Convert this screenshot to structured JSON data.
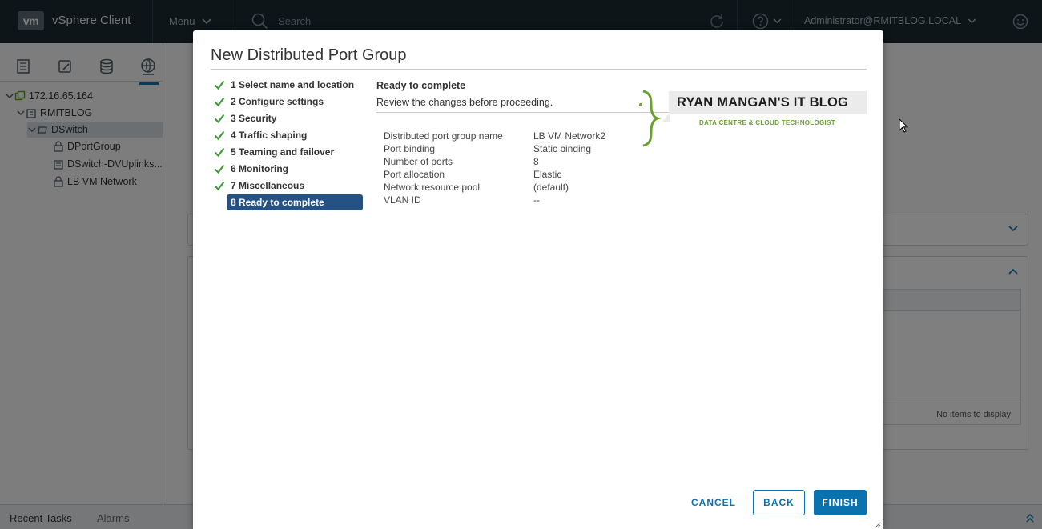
{
  "topbar": {
    "logo": "vm",
    "app_title": "vSphere Client",
    "menu_label": "Menu",
    "search_placeholder": "Search",
    "user_label": "Administrator@RMITBLOG.LOCAL"
  },
  "sidebar": {
    "tabs": [
      "hosts-clusters-icon",
      "vms-templates-icon",
      "storage-icon",
      "networking-icon"
    ],
    "tree": [
      {
        "label": "172.16.65.164",
        "icon": "vcenter-icon"
      },
      {
        "label": "RMITBLOG",
        "icon": "datacenter-icon"
      },
      {
        "label": "DSwitch",
        "icon": "distributed-switch-icon"
      },
      {
        "label": "DPortGroup",
        "icon": "port-group-icon"
      },
      {
        "label": "DSwitch-DVUplinks...",
        "icon": "uplink-icon"
      },
      {
        "label": "LB VM Network",
        "icon": "port-group-icon"
      }
    ]
  },
  "background": {
    "no_items_text": "No items to display"
  },
  "bottom_bar": {
    "recent_tasks": "Recent Tasks",
    "alarms": "Alarms"
  },
  "dialog": {
    "title": "New Distributed Port Group",
    "steps": [
      "1 Select name and location",
      "2 Configure settings",
      "3 Security",
      "4 Traffic shaping",
      "5 Teaming and failover",
      "6 Monitoring",
      "7 Miscellaneous",
      "8 Ready to complete"
    ],
    "current_step": 8,
    "heading": "Ready to complete",
    "subheading": "Review the changes before proceeding.",
    "summary": [
      {
        "key": "Distributed port group name",
        "value": "LB VM Network2"
      },
      {
        "key": "Port binding",
        "value": "Static binding"
      },
      {
        "key": "Number of ports",
        "value": "8"
      },
      {
        "key": "Port allocation",
        "value": "Elastic"
      },
      {
        "key": "Network resource pool",
        "value": "(default)"
      },
      {
        "key": "VLAN ID",
        "value": "--"
      }
    ],
    "watermark_title": "RYAN MANGAN'S IT BLOG",
    "watermark_sub": "DATA CENTRE & CLOUD TECHNOLOGIST",
    "buttons": {
      "cancel": "CANCEL",
      "back": "BACK",
      "finish": "FINISH"
    }
  },
  "colors": {
    "topbar": "#1b2a32",
    "accent": "#0b72b0",
    "active_step": "#265183",
    "check": "#3f9b3a"
  }
}
